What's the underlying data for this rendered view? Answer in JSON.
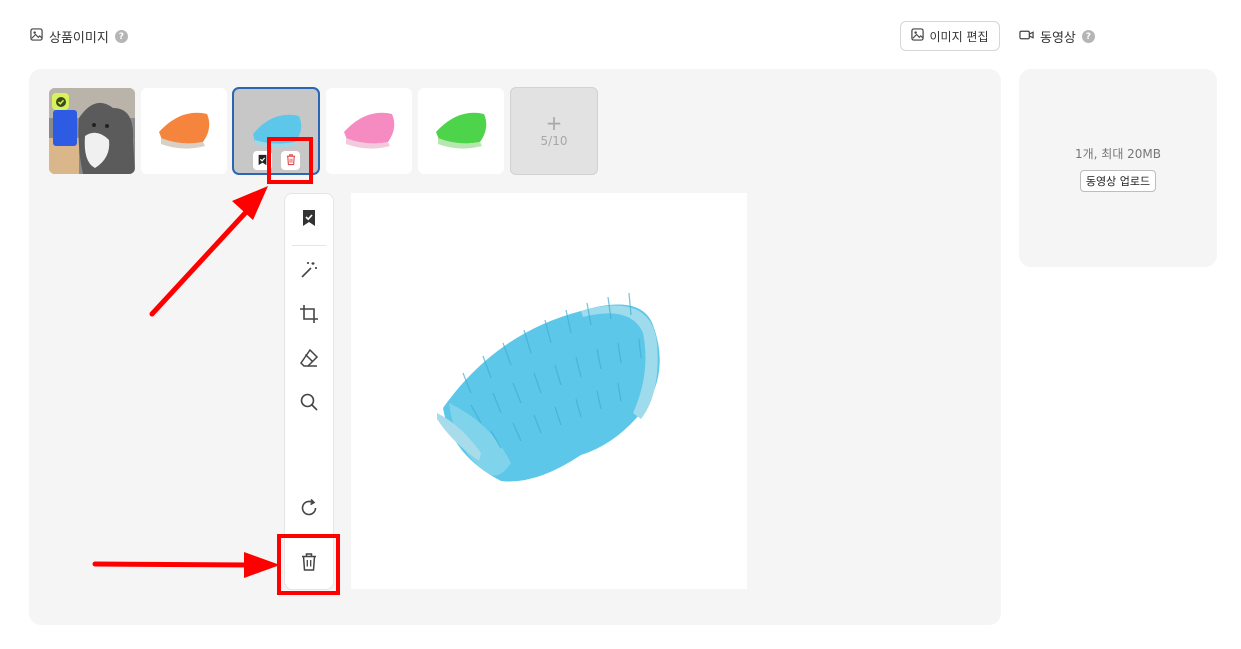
{
  "product_images": {
    "title": "상품이미지",
    "help": "?",
    "edit_button_label": "이미지 편집",
    "add_tile": {
      "plus": "+",
      "count": "5/10"
    },
    "thumbnails": [
      {
        "name": "cat-with-blue-brush",
        "representative": true,
        "selected": false
      },
      {
        "name": "orange-brush",
        "representative": false,
        "selected": false
      },
      {
        "name": "blue-brush",
        "representative": false,
        "selected": true
      },
      {
        "name": "pink-brush",
        "representative": false,
        "selected": false
      },
      {
        "name": "green-brush",
        "representative": false,
        "selected": false
      }
    ],
    "toolbar_tools": [
      "set-representative",
      "auto-enhance",
      "crop",
      "erase",
      "zoom",
      "rotate",
      "delete"
    ]
  },
  "video": {
    "title": "동영상",
    "help": "?",
    "info": "1개, 최대 20MB",
    "upload_label": "동영상 업로드"
  },
  "colors": {
    "accent_selected": "#2b66b6",
    "annotation_red": "#ff0000",
    "panel_bg": "#f5f5f5",
    "brush_blue": "#5cc7e8",
    "brush_orange": "#f5843c",
    "brush_pink": "#f58bc0",
    "brush_green": "#4ed44a",
    "representative_badge": "#d7f25c"
  }
}
